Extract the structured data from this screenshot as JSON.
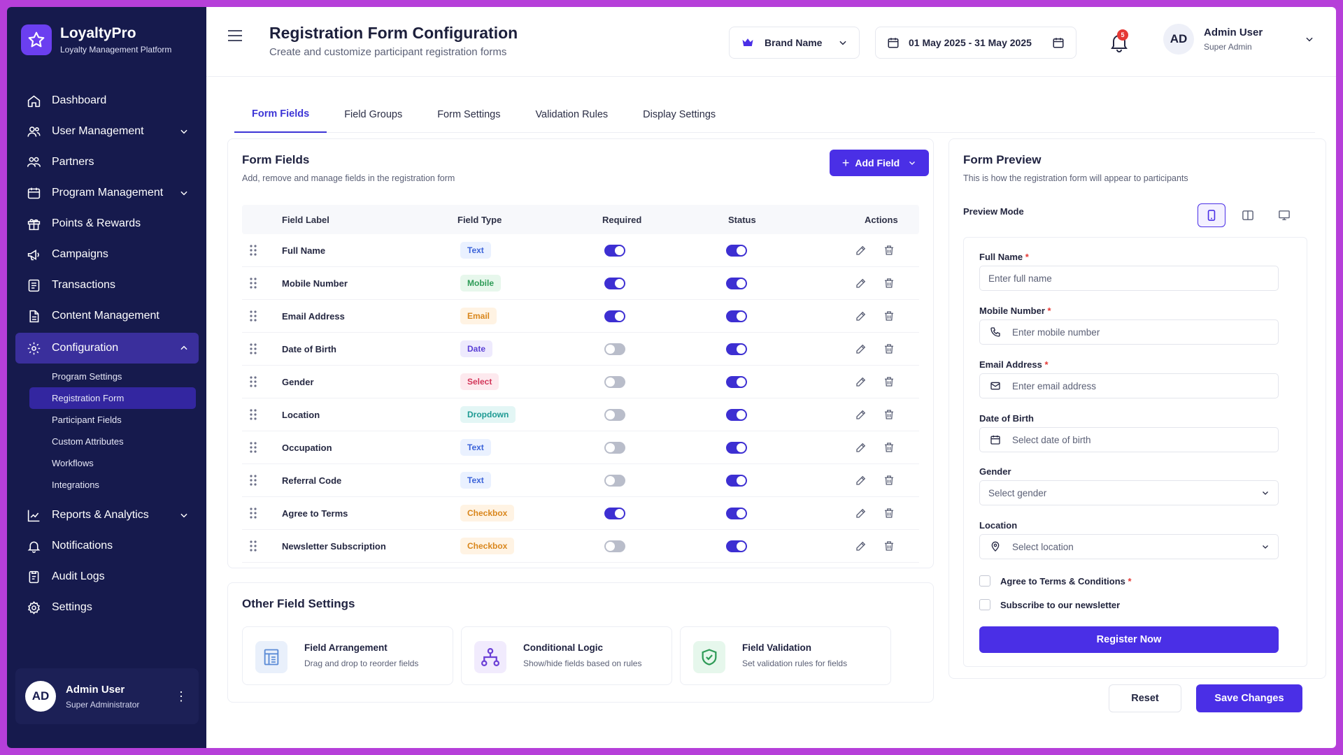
{
  "app": {
    "name": "LoyaltyPro",
    "tagline": "Loyalty Management Platform"
  },
  "sidebar": {
    "items": [
      {
        "label": "Dashboard"
      },
      {
        "label": "User Management"
      },
      {
        "label": "Partners"
      },
      {
        "label": "Program Management"
      },
      {
        "label": "Points & Rewards"
      },
      {
        "label": "Campaigns"
      },
      {
        "label": "Transactions"
      },
      {
        "label": "Content Management"
      },
      {
        "label": "Configuration"
      },
      {
        "label": "Reports & Analytics"
      },
      {
        "label": "Notifications"
      },
      {
        "label": "Audit Logs"
      },
      {
        "label": "Settings"
      }
    ],
    "config_sub": [
      "Program Settings",
      "Registration Form",
      "Participant Fields",
      "Custom Attributes",
      "Workflows",
      "Integrations"
    ],
    "user": {
      "initials": "AD",
      "name": "Admin User",
      "role": "Super Administrator"
    }
  },
  "header": {
    "title": "Registration Form Configuration",
    "subtitle": "Create and customize participant registration forms",
    "brand": "Brand Name",
    "date_range": "01 May 2025 - 31 May 2025",
    "notif_count": "5",
    "user": {
      "initials": "AD",
      "name": "Admin User",
      "role": "Super Admin"
    }
  },
  "tabs": [
    "Form Fields",
    "Field Groups",
    "Form Settings",
    "Validation Rules",
    "Display Settings"
  ],
  "form_fields": {
    "title": "Form Fields",
    "subtitle": "Add, remove and manage fields in the registration form",
    "add_label": "Add Field",
    "columns": {
      "label": "Field Label",
      "type": "Field Type",
      "required": "Required",
      "status": "Status",
      "actions": "Actions"
    },
    "rows": [
      {
        "label": "Full Name",
        "type": "Text",
        "required": true,
        "status": true
      },
      {
        "label": "Mobile Number",
        "type": "Mobile",
        "required": true,
        "status": true
      },
      {
        "label": "Email Address",
        "type": "Email",
        "required": true,
        "status": true
      },
      {
        "label": "Date of Birth",
        "type": "Date",
        "required": false,
        "status": true
      },
      {
        "label": "Gender",
        "type": "Select",
        "required": false,
        "status": true
      },
      {
        "label": "Location",
        "type": "Dropdown",
        "required": false,
        "status": true
      },
      {
        "label": "Occupation",
        "type": "Text",
        "required": false,
        "status": true
      },
      {
        "label": "Referral Code",
        "type": "Text",
        "required": false,
        "status": true
      },
      {
        "label": "Agree to Terms",
        "type": "Checkbox",
        "required": true,
        "status": true
      },
      {
        "label": "Newsletter Subscription",
        "type": "Checkbox",
        "required": false,
        "status": true
      }
    ],
    "type_colors": {
      "Text": {
        "bg": "#eaf1ff",
        "fg": "#3b63d9"
      },
      "Mobile": {
        "bg": "#e7f7ec",
        "fg": "#2e9b57"
      },
      "Email": {
        "bg": "#fff3e3",
        "fg": "#d9861c"
      },
      "Date": {
        "bg": "#eeeafd",
        "fg": "#5a3fd6"
      },
      "Select": {
        "bg": "#fde9ee",
        "fg": "#d3365a"
      },
      "Dropdown": {
        "bg": "#e3f6f5",
        "fg": "#1d9a93"
      },
      "Checkbox": {
        "bg": "#fff3e3",
        "fg": "#d9861c"
      }
    }
  },
  "other_settings": {
    "title": "Other Field Settings",
    "cards": [
      {
        "title": "Field Arrangement",
        "subtitle": "Drag and drop to reorder fields",
        "icon": "layout-icon"
      },
      {
        "title": "Conditional Logic",
        "subtitle": "Show/hide fields based on rules",
        "icon": "flow-icon"
      },
      {
        "title": "Field Validation",
        "subtitle": "Set validation rules for fields",
        "icon": "shield-check-icon"
      }
    ]
  },
  "preview": {
    "title": "Form Preview",
    "subtitle": "This is how the registration form will appear to participants",
    "mode_label": "Preview Mode",
    "fields": [
      {
        "label": "Full Name",
        "required": "*",
        "placeholder": "Enter full name"
      },
      {
        "label": "Mobile Number",
        "required": "*",
        "placeholder": "Enter mobile number"
      },
      {
        "label": "Email Address",
        "required": "*",
        "placeholder": "Enter email address"
      },
      {
        "label": "Date of Birth",
        "required": "",
        "placeholder": "Select date of birth"
      },
      {
        "label": "Gender",
        "required": "",
        "placeholder": "Select gender"
      },
      {
        "label": "Location",
        "required": "",
        "placeholder": "Select location"
      }
    ],
    "terms": "Agree to Terms & Conditions",
    "terms_req": "*",
    "newsletter": "Subscribe to our newsletter",
    "submit": "Register Now"
  },
  "footer": {
    "reset": "Reset",
    "save": "Save Changes"
  },
  "colors": {
    "primary": "#4a2fe6",
    "sidebar": "#161a4d",
    "frame": "#b63fd9"
  }
}
